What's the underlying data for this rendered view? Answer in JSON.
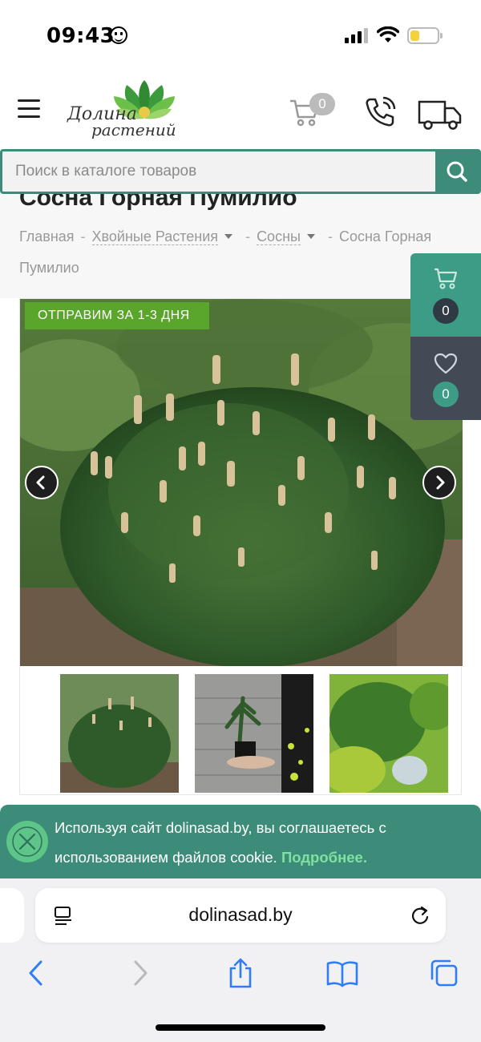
{
  "status_bar": {
    "time": "09:43"
  },
  "header": {
    "logo_line1": "Долина",
    "logo_line2": "растений",
    "cart_count": "0"
  },
  "search": {
    "placeholder": "Поиск в каталоге товаров"
  },
  "product": {
    "title": "Сосна Горная Пумилио",
    "breadcrumb": [
      {
        "label": "Главная"
      },
      {
        "label": "Хвойные Растения"
      },
      {
        "label": "Сосны"
      },
      {
        "label": "Сосна Горная Пумилио"
      }
    ],
    "shipping_badge": "ОТПРАВИМ ЗА 1-3 ДНЯ"
  },
  "side_panel": {
    "cart_count": "0",
    "favorites_count": "0"
  },
  "cookie": {
    "text": "Используя сайт dolinasad.by, вы соглашаетесь с использованием файлов cookie.",
    "more_link": "Подробнее."
  },
  "browser": {
    "url": "dolinasad.by"
  },
  "colors": {
    "accent": "#3d8c79",
    "badge_green": "#5aa52c",
    "side_cart": "#3d9c85",
    "side_fav": "#424a55"
  }
}
